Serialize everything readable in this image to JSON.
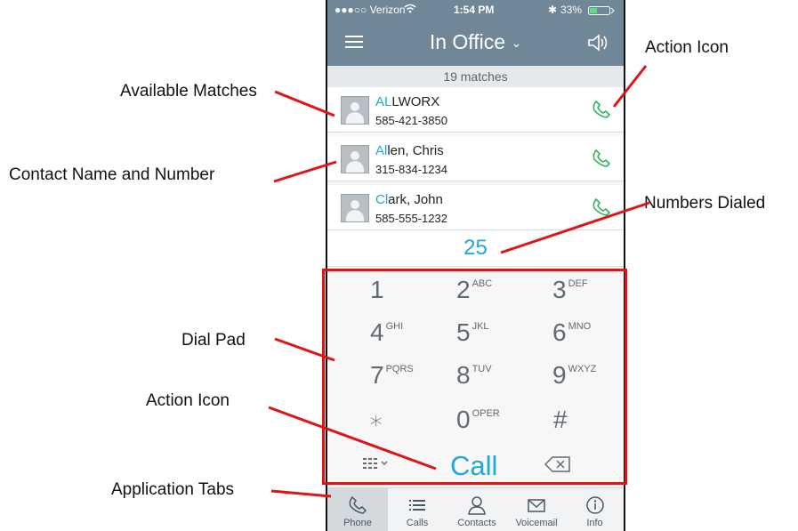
{
  "status_bar": {
    "carrier": "●●●○○ Verizon",
    "time": "1:54 PM",
    "battery": "33%"
  },
  "nav": {
    "title": "In Office",
    "menu_icon": "hamburger-icon",
    "speaker_icon": "speaker-icon"
  },
  "matches": "19 matches",
  "contacts": [
    {
      "name_highlight": "AL",
      "name_rest": "LWORX",
      "number": "585-421-3850"
    },
    {
      "name_highlight": "Al",
      "name_rest": "len, Chris",
      "number": "315-834-1234"
    },
    {
      "name_highlight": "Cl",
      "name_rest": "ark, John",
      "number": "585-555-1232"
    }
  ],
  "dialed": "25",
  "keypad": {
    "keys": [
      {
        "digit": "1",
        "letters": ""
      },
      {
        "digit": "2",
        "letters": "ABC"
      },
      {
        "digit": "3",
        "letters": "DEF"
      },
      {
        "digit": "4",
        "letters": "GHI"
      },
      {
        "digit": "5",
        "letters": "JKL"
      },
      {
        "digit": "6",
        "letters": "MNO"
      },
      {
        "digit": "7",
        "letters": "PQRS"
      },
      {
        "digit": "8",
        "letters": "TUV"
      },
      {
        "digit": "9",
        "letters": "WXYZ"
      },
      {
        "digit": "∗",
        "letters": ""
      },
      {
        "digit": "0",
        "letters": "OPER"
      },
      {
        "digit": "#",
        "letters": ""
      }
    ],
    "call_label": "Call"
  },
  "tabs": [
    {
      "label": "Phone",
      "icon": "phone-icon"
    },
    {
      "label": "Calls",
      "icon": "list-icon"
    },
    {
      "label": "Contacts",
      "icon": "person-icon"
    },
    {
      "label": "Voicemail",
      "icon": "envelope-icon"
    },
    {
      "label": "Info",
      "icon": "info-icon"
    }
  ],
  "annotations": {
    "available_matches": "Available Matches",
    "contact_name_number": "Contact Name and Number",
    "dial_pad": "Dial Pad",
    "action_icon_bottom": "Action Icon",
    "application_tabs": "Application Tabs",
    "action_icon_top": "Action Icon",
    "numbers_dialed": "Numbers Dialed"
  },
  "colors": {
    "accent": "#1fa8d8",
    "header": "#6f8796",
    "call_green": "#2fb35a",
    "annotation_red": "#e01414"
  }
}
